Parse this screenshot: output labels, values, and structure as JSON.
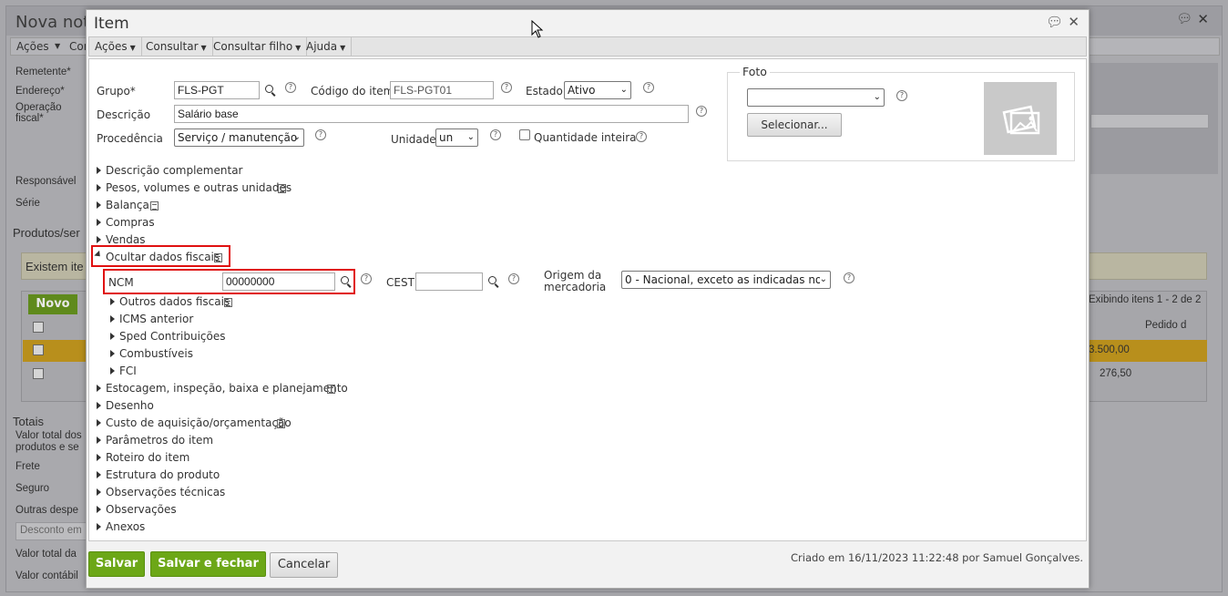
{
  "background": {
    "title": "Nova nota",
    "menu": [
      "Ações",
      "Con"
    ],
    "labels": {
      "remetente": "Remetente*",
      "endereco": "Endereço*",
      "operacao": "Operação fiscal*",
      "responsavel": "Responsável",
      "serie": "Série",
      "produtos": "Produtos/ser",
      "existem": "Existem ite",
      "novo": "Novo",
      "exibindo": "Exibindo itens 1 - 2 de 2",
      "pedido": "Pedido d",
      "valor1": "3.500,00",
      "valor2": "276,50",
      "totais": "Totais",
      "valor_total_dos": "Valor total dos produtos e se",
      "frete": "Frete",
      "seguro": "Seguro",
      "outras": "Outras despe",
      "desconto": "Desconto em",
      "valor_total_da": "Valor total da",
      "valor_contabil": "Valor contábil"
    }
  },
  "modal": {
    "title": "Item",
    "menu": [
      {
        "label": "Ações"
      },
      {
        "label": "Consultar"
      },
      {
        "label": "Consultar filho"
      },
      {
        "label": "Ajuda"
      }
    ],
    "form": {
      "grupo_label": "Grupo*",
      "grupo_value": "FLS-PGT",
      "codigo_label": "Código do item",
      "codigo_value": "FLS-PGT01",
      "estado_label": "Estado",
      "estado_value": "Ativo",
      "descricao_label": "Descrição",
      "descricao_value": "Salário base",
      "procedencia_label": "Procedência",
      "procedencia_value": "Serviço / manutenção",
      "unidade_label": "Unidade",
      "unidade_value": "un",
      "quantidade_label": "Quantidade inteira"
    },
    "foto": {
      "legend": "Foto",
      "select_value": "",
      "button": "Selecionar..."
    },
    "sections": {
      "descricao_complementar": "Descrição complementar",
      "pesos": "Pesos, volumes e outras unidades",
      "balanca": "Balança",
      "compras": "Compras",
      "vendas": "Vendas",
      "ocultar_fiscais": "Ocultar dados fiscais",
      "outros_fiscais": "Outros dados fiscais",
      "icms": "ICMS anterior",
      "sped": "Sped Contribuições",
      "combustiveis": "Combustíveis",
      "fci": "FCI",
      "estocagem": "Estocagem, inspeção, baixa e planejamento",
      "desenho": "Desenho",
      "custo": "Custo de aquisição/orçamentação",
      "parametros": "Parâmetros do item",
      "roteiro": "Roteiro do item",
      "estrutura": "Estrutura do produto",
      "obs_tecnicas": "Observações técnicas",
      "observacoes": "Observações",
      "anexos": "Anexos"
    },
    "fiscal": {
      "ncm_label": "NCM",
      "ncm_value": "00000000",
      "cest_label": "CEST",
      "cest_value": "",
      "origem_label": "Origem da mercadoria",
      "origem_value": "0 - Nacional, exceto as indicadas nos c"
    },
    "footer": {
      "salvar": "Salvar",
      "salvar_fechar": "Salvar e fechar",
      "cancelar": "Cancelar",
      "criado": "Criado em 16/11/2023 11:22:48 por Samuel Gonçalves."
    }
  }
}
